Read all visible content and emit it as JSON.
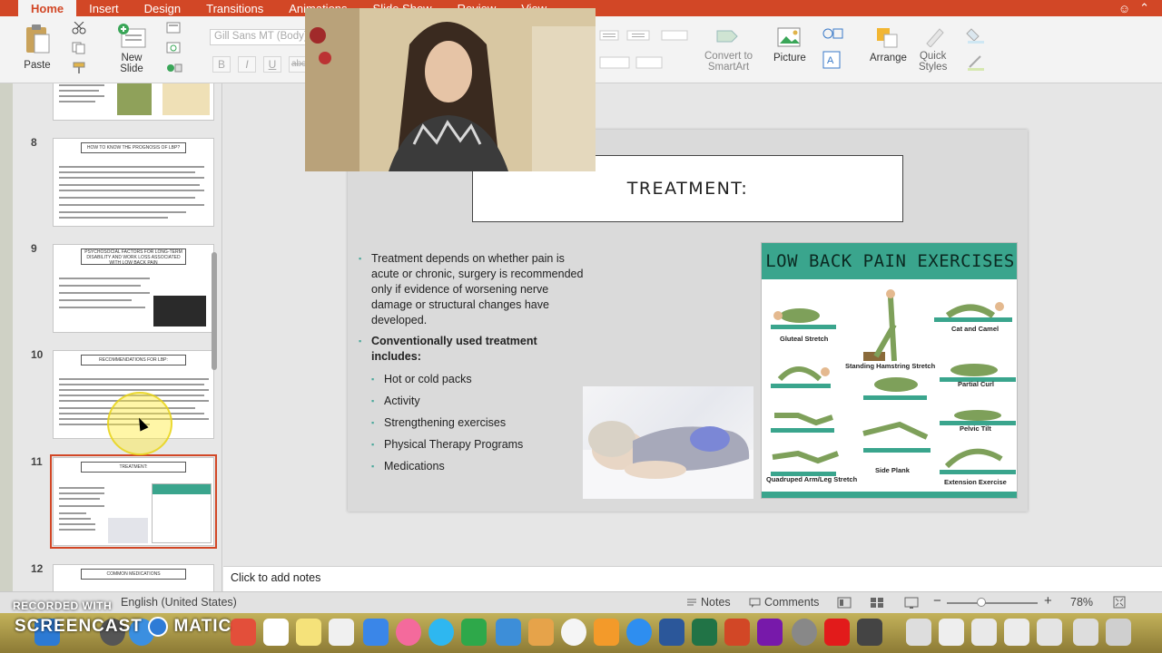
{
  "ribbon_tabs": [
    {
      "label": "Home"
    },
    {
      "label": "Insert"
    },
    {
      "label": "Design"
    },
    {
      "label": "Transitions"
    },
    {
      "label": "Animations"
    },
    {
      "label": "Slide Show"
    },
    {
      "label": "Review"
    },
    {
      "label": "View"
    }
  ],
  "ribbon": {
    "paste": "Paste",
    "new_slide": "New\nSlide",
    "font_name": "Gill Sans MT (Body)",
    "convert_smartart": "Convert to\nSmartArt",
    "picture": "Picture",
    "arrange": "Arrange",
    "quick_styles": "Quick\nStyles",
    "format_buttons": [
      "B",
      "I",
      "U",
      "abc"
    ]
  },
  "thumbnails": [
    {
      "num": "",
      "title": ""
    },
    {
      "num": "8",
      "title": "HOW TO KNOW THE PROGNOSIS OF LBP?"
    },
    {
      "num": "9",
      "title": "PSYCHOSOCIAL FACTORS FOR LONG-TERM DISABILITY AND WORK LOSS ASSOCIATED WITH LOW BACK PAIN"
    },
    {
      "num": "10",
      "title": "RECOMMENDATIONS FOR LBP:"
    },
    {
      "num": "11",
      "title": "TREATMENT:"
    },
    {
      "num": "12",
      "title": "COMMON MEDICATIONS"
    }
  ],
  "slide": {
    "title": "TREATMENT:",
    "bullet_main": "Treatment depends on whether pain is acute or chronic, surgery is recommended only if evidence of worsening nerve damage or structural changes have developed.",
    "bullet_conv": "Conventionally used treatment includes:",
    "sub_bullets": [
      "Hot or cold packs",
      "Activity",
      "Strengthening exercises",
      "Physical Therapy Programs",
      "Medications"
    ],
    "exercise_title": "LOW BACK PAIN EXERCISES",
    "exercise_labels": [
      "Gluteal Stretch",
      "Cat and Camel",
      "Standing Hamstring Stretch",
      "Partial Curl",
      "Pelvic Tilt",
      "Side Plank",
      "Quadruped Arm/Leg Stretch",
      "Extension Exercise"
    ]
  },
  "notes_placeholder": "Click to add notes",
  "status": {
    "language": "English (United States)",
    "notes": "Notes",
    "comments": "Comments",
    "zoom": "78%"
  },
  "watermark": {
    "small": "RECORDED WITH",
    "big": "SCREENCAST",
    "big_tail": "MATIC"
  },
  "colors": {
    "accent": "#d24726",
    "teal": "#3aa58d"
  }
}
